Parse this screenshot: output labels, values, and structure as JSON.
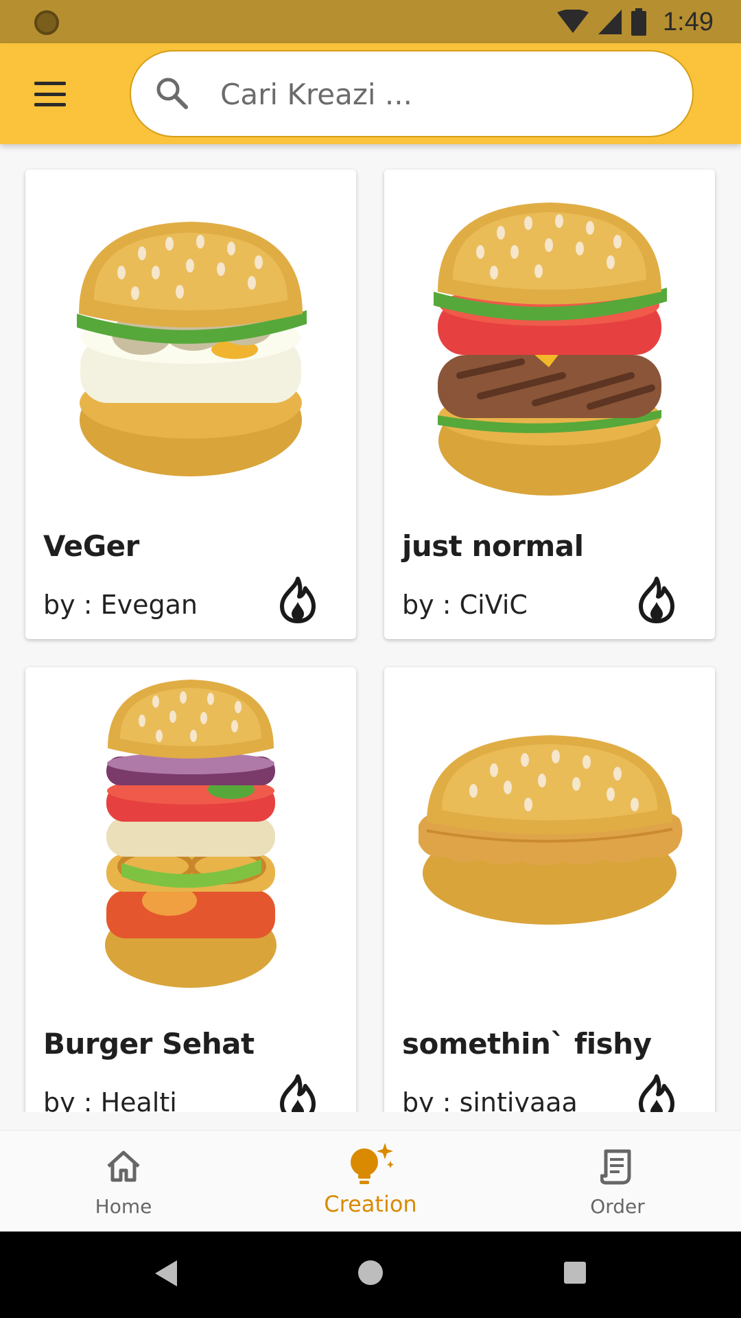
{
  "status_bar": {
    "time": "1:49",
    "icons": [
      "notification-icon",
      "wifi-icon",
      "signal-icon",
      "battery-icon"
    ]
  },
  "app_bar": {
    "menu_icon": "hamburger-menu-icon",
    "search": {
      "placeholder": "Cari Kreazi ...",
      "value": ""
    }
  },
  "creations": [
    {
      "title": "VeGer",
      "author": "by : Evegan",
      "image": "veggie-burger"
    },
    {
      "title": "just normal",
      "author": "by : CiViC",
      "image": "beef-burger"
    },
    {
      "title": "Burger Sehat",
      "author": "by : Healti",
      "image": "healthy-burger"
    },
    {
      "title": "somethin` fishy",
      "author": "by : sintiyaaa",
      "image": "fish-burger"
    }
  ],
  "bottom_nav": {
    "active": "Creation",
    "items": [
      {
        "label": "Home",
        "icon": "home-icon"
      },
      {
        "label": "Creation",
        "icon": "lightbulb-icon"
      },
      {
        "label": "Order",
        "icon": "receipt-icon"
      }
    ]
  },
  "colors": {
    "status_bar": "#b68f30",
    "app_bar": "#fbc23b",
    "accent": "#d98a00"
  }
}
